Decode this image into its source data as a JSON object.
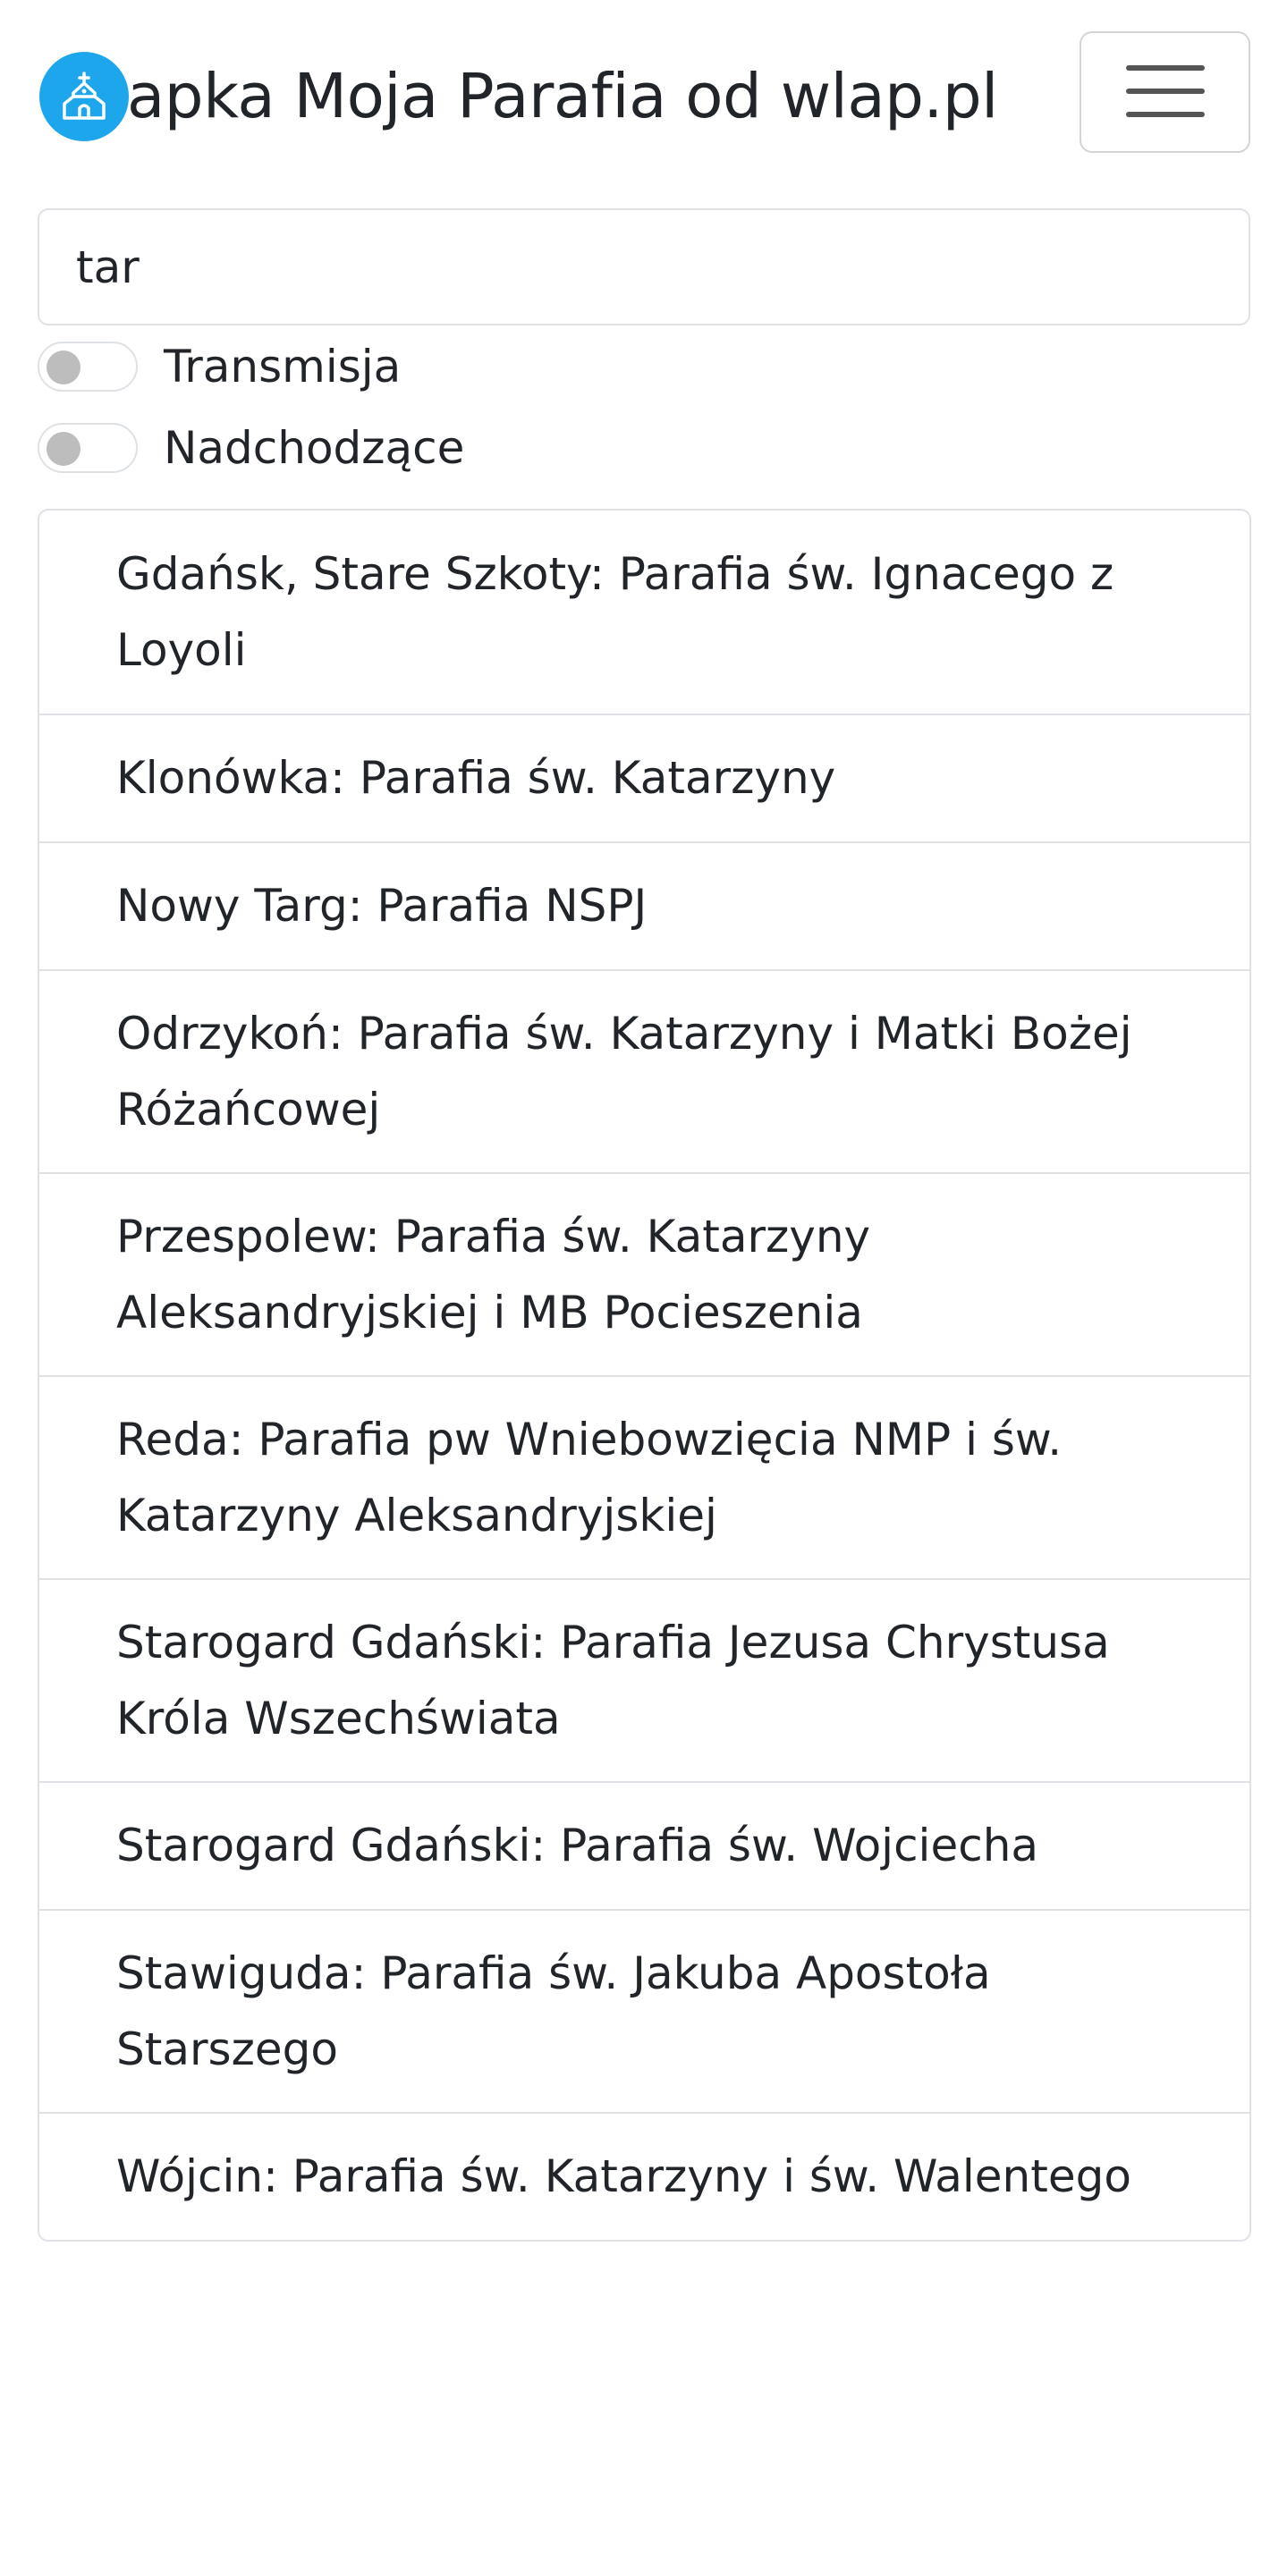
{
  "header": {
    "title": "apka Moja Parafia od wlap.pl",
    "logo_icon": "church-icon",
    "menu_icon": "hamburger-menu-icon",
    "logo_color": "#1ea6ec"
  },
  "search": {
    "value": "tar"
  },
  "filters": [
    {
      "label": "Transmisja",
      "checked": false
    },
    {
      "label": "Nadchodzące",
      "checked": false
    }
  ],
  "parishes": [
    "Gdańsk, Stare Szkoty: Parafia św. Ignacego z Loyoli",
    "Klonówka: Parafia św. Katarzyny",
    "Nowy Targ: Parafia NSPJ",
    "Odrzykoń: Parafia św. Katarzyny i Matki Bożej Różańcowej",
    "Przespolew: Parafia św. Katarzyny Aleksandryjskiej i MB Pocieszenia",
    "Reda: Parafia pw Wniebowzięcia NMP i św. Katarzyny Aleksandryjskiej",
    "Starogard Gdański: Parafia Jezusa Chrystusa Króla Wszechświata",
    "Starogard Gdański: Parafia św. Wojciecha",
    "Stawiguda: Parafia św. Jakuba Apostoła Starszego",
    "Wójcin: Parafia św. Katarzyny i św. Walentego"
  ]
}
